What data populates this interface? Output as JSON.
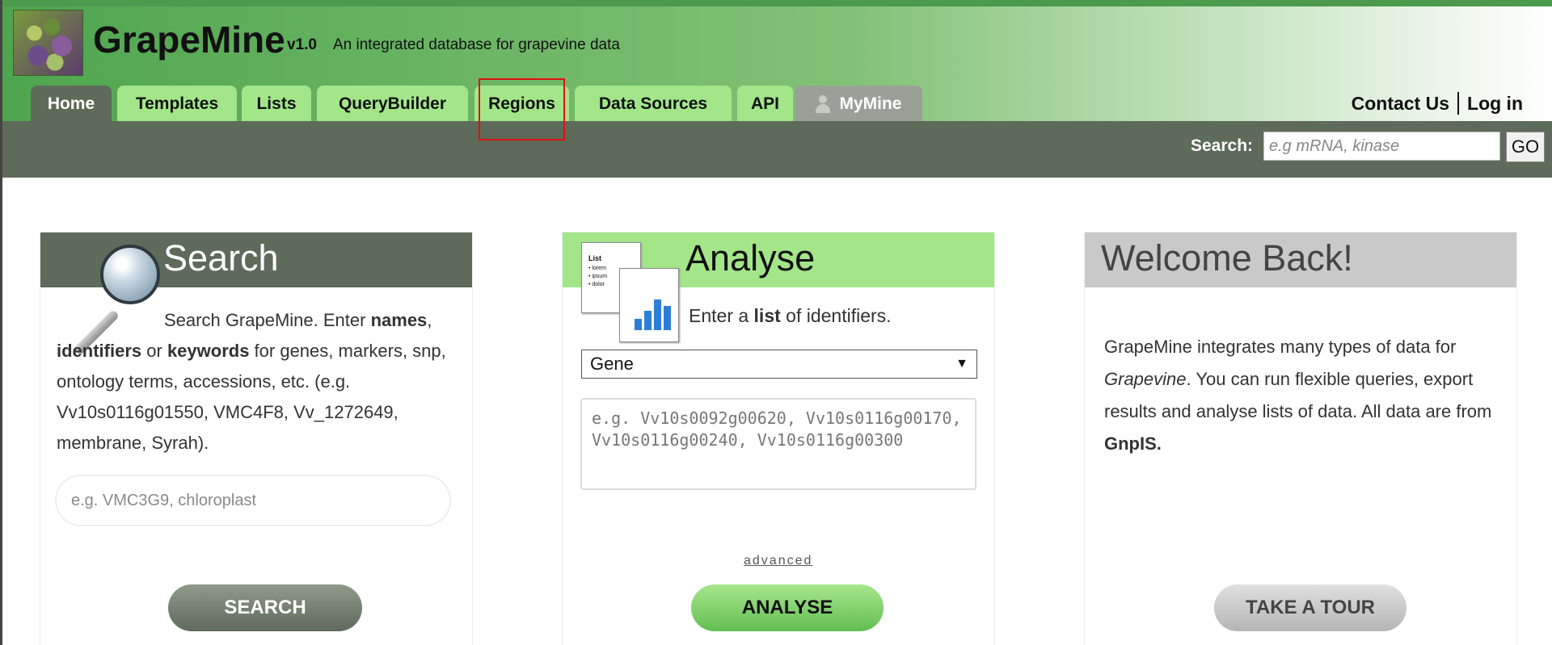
{
  "header": {
    "brand": "GrapeMine",
    "version": "v1.0",
    "tagline": "An integrated database for grapevine data"
  },
  "tabs": [
    {
      "label": "Home",
      "active": true
    },
    {
      "label": "Templates"
    },
    {
      "label": "Lists"
    },
    {
      "label": "QueryBuilder"
    },
    {
      "label": "Regions",
      "highlighted": true
    },
    {
      "label": "Data Sources"
    },
    {
      "label": "API"
    },
    {
      "label": "MyMine",
      "icon": "person-icon"
    }
  ],
  "top_links": {
    "contact": "Contact Us",
    "login": "Log in"
  },
  "quick_search": {
    "label": "Search:",
    "placeholder": "e.g mRNA, kinase",
    "button": "GO"
  },
  "search_panel": {
    "title": "Search",
    "intro": {
      "p1": "Search GrapeMine. Enter ",
      "b1": "names",
      "p2": ", ",
      "b2": "identifiers",
      "p3": " or ",
      "b3": "keywords",
      "p4": " for genes, markers, snp, ontology terms, accessions, etc. (e.g. Vv10s0116g01550, VMC4F8, Vv_1272649, membrane, Syrah)."
    },
    "input_placeholder": "e.g. VMC3G9, chloroplast",
    "button": "SEARCH"
  },
  "analyse_panel": {
    "title": "Analyse",
    "intro": {
      "p1": "Enter a ",
      "b1": "list",
      "p2": " of identifiers."
    },
    "list_icon": {
      "title": "List",
      "lines": [
        "• lorem",
        "• ipsum",
        "• dolor"
      ]
    },
    "type_select": "Gene",
    "ids_placeholder": "e.g. Vv10s0092g00620, Vv10s0116g00170, Vv10s0116g00240, Vv10s0116g00300",
    "advanced": "advanced",
    "button": "ANALYSE"
  },
  "welcome_panel": {
    "title": "Welcome Back!",
    "text": {
      "p1": "GrapeMine integrates many types of data for ",
      "i1": "Grapevine",
      "p2": ". You can run flexible queries, export results and analyse lists of data. All data are from ",
      "b1": "GnpIS."
    },
    "button": "TAKE A TOUR"
  },
  "colors": {
    "accent_green": "#a3e68a",
    "dark_bar": "#5e6a5a",
    "highlight_red": "#e01010"
  }
}
